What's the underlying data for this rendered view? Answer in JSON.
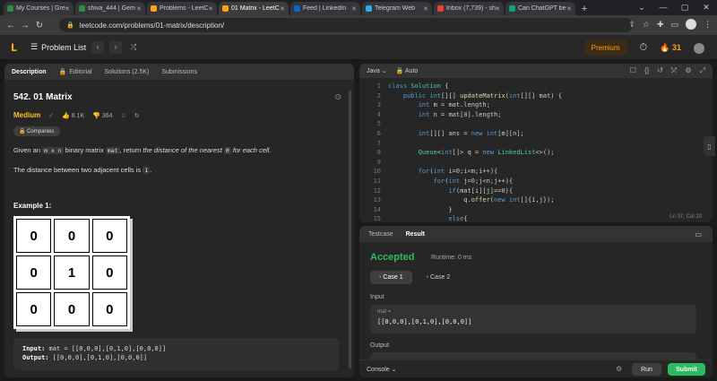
{
  "browser": {
    "tabs": [
      {
        "label": "My Courses | Gre",
        "color": "#2f8d46"
      },
      {
        "label": "shiva_444 | Gem",
        "color": "#2f8d46"
      },
      {
        "label": "Problems - LeetC",
        "color": "#ffa116"
      },
      {
        "label": "01 Matrix - LeetC",
        "color": "#ffa116"
      },
      {
        "label": "Feed | LinkedIn",
        "color": "#0a66c2"
      },
      {
        "label": "Telegram Web",
        "color": "#2aabee"
      },
      {
        "label": "Inbox (7,739) - sh",
        "color": "#ea4335"
      },
      {
        "label": "Can ChatGPT be",
        "color": "#10a37f"
      }
    ],
    "url": "leetcode.com/problems/01-matrix/description/"
  },
  "header": {
    "problem_list": "Problem List",
    "premium": "Premium",
    "streak": "31"
  },
  "left_tabs": [
    "Description",
    "Editorial",
    "Solutions (2.5K)",
    "Submissions"
  ],
  "problem": {
    "title": "542. 01 Matrix",
    "difficulty": "Medium",
    "likes": "8.1K",
    "dislikes": "364",
    "companies": "Companies",
    "text_a": "Given an ",
    "code_a": "m x n",
    "text_b": " binary matrix ",
    "code_b": "mat",
    "text_c": ", return ",
    "text_d": "the distance of the nearest ",
    "code_c": "0",
    "text_e": " for each cell.",
    "text_f": "The distance between two adjacent cells is ",
    "code_d": "1",
    "text_g": ".",
    "example_label": "Example 1:",
    "matrix": [
      "0",
      "0",
      "0",
      "0",
      "1",
      "0",
      "0",
      "0",
      "0"
    ],
    "input_label": "Input:",
    "input_val": " mat = [[0,0,0],[0,1,0],[0,0,0]]",
    "output_label": "Output:",
    "output_val": " [[0,0,0],[0,1,0],[0,0,0]]"
  },
  "editor": {
    "language": "Java",
    "mode": "Auto",
    "position": "Ln 37, Col 20"
  },
  "result": {
    "tabs": [
      "Testcase",
      "Result"
    ],
    "status": "Accepted",
    "runtime": "Runtime: 0 ms",
    "case1": "Case 1",
    "case2": "Case 2",
    "input_label": "Input",
    "var": "mat =",
    "value": "[[0,0,0],[0,1,0],[0,0,0]]",
    "output_label": "Output",
    "console": "Console",
    "run": "Run",
    "submit": "Submit"
  }
}
